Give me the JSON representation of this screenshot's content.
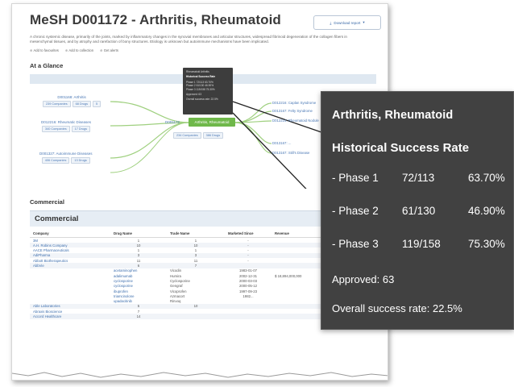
{
  "page": {
    "title": "MeSH D001172 - Arthritis, Rheumatoid",
    "download_label": "Download report",
    "description": "A chronic systemic disease, primarily of the joints, marked by inflammatory changes in the synovial membranes and articular structures, widespread fibrinoid degeneration of the collagen fibers in mesenchymal tissues, and by atrophy and rarefaction of bony structures. Etiology is unknown but autoimmune mechanisms have been implicated.",
    "links": [
      "Add to favourites",
      "Add to collection",
      "Get alerts"
    ]
  },
  "glance": {
    "heading": "At a Glance",
    "left_nodes": [
      {
        "label": "D001168: Arthritis",
        "chips": [
          "239 Companies",
          "68 Drugs",
          "5"
        ]
      },
      {
        "label": "D012216: Rheumatic Diseases",
        "chips": [
          "340 Companies",
          "17 Drugs"
        ]
      },
      {
        "label": "D001327: Autoimmune Diseases",
        "chips": [
          "406 Companies",
          "13 Drugs"
        ]
      }
    ],
    "center": {
      "id": "D001172",
      "label": "Arthritis, Rheumatoid",
      "chips": [
        "234 Companies",
        "386 Drugs"
      ]
    },
    "right_nodes": [
      "D012216: Caplan Syndrome",
      "D013167: Felty Syndrome",
      "D012214: Rheumatoid Nodule",
      "D013167: ...",
      "D013167: Still's Disease"
    ],
    "mini_tooltip": {
      "name": "Rheumatoid Arthritis",
      "heading": "Historical Success Rate",
      "rows": [
        "Phase 1  72/113  63.70%",
        "Phase 2  61/130  46.90%",
        "Phase 3  119/158  75.30%"
      ],
      "approved": "Approved: 63",
      "overall": "Overall success rate: 22.5%"
    }
  },
  "commercial": {
    "heading": "Commercial",
    "box_title": "Commercial",
    "columns": [
      "Company",
      "Drug Name",
      "Trade Name",
      "Marketed Since",
      "Revenue"
    ],
    "rows": [
      {
        "company": "3M",
        "drug": "1",
        "trade": "1",
        "since": "-",
        "rev": "",
        "shade": false
      },
      {
        "company": "A.H. Robins Company",
        "drug": "10",
        "trade": "10",
        "since": "-",
        "rev": "",
        "shade": true
      },
      {
        "company": "AACE Pharmaceuticals",
        "drug": "1",
        "trade": "1",
        "since": "-",
        "rev": "",
        "shade": false
      },
      {
        "company": "AdiPharma",
        "drug": "3",
        "trade": "3",
        "since": "-",
        "rev": "",
        "shade": true
      },
      {
        "company": "Abbott Biotherapeutics",
        "drug": "11",
        "trade": "11",
        "since": "-",
        "rev": "",
        "shade": false
      },
      {
        "company": "AbbVie",
        "drug": "6",
        "trade": "7",
        "since": "",
        "rev": "",
        "shade": true
      },
      {
        "company": "",
        "drug": "acetaminophen",
        "trade": "Vicodin",
        "since": "1983-01-07",
        "rev": "",
        "shade": false
      },
      {
        "company": "",
        "drug": "adalimumab",
        "trade": "Humira",
        "since": "2002-12-31",
        "rev": "$  18,894,000,000",
        "shade": false
      },
      {
        "company": "",
        "drug": "cyclosporine",
        "trade": "Cyclosporine",
        "since": "2000-03-03",
        "rev": "",
        "shade": false
      },
      {
        "company": "",
        "drug": "cyclosporine",
        "trade": "Gengraf",
        "since": "2000-05-12",
        "rev": "",
        "shade": false
      },
      {
        "company": "",
        "drug": "ibuprofen",
        "trade": "Vicoprofen",
        "since": "1997-09-23",
        "rev": "",
        "shade": false
      },
      {
        "company": "",
        "drug": "triamcinolone",
        "trade": "Azmacort",
        "since": "1982...",
        "rev": "",
        "shade": false
      },
      {
        "company": "",
        "drug": "upadacitinib",
        "trade": "Rinvoq",
        "since": "",
        "rev": "",
        "shade": false
      },
      {
        "company": "Able Laboratories",
        "drug": "5",
        "trade": "10",
        "since": "",
        "rev": "",
        "shade": true
      },
      {
        "company": "Abraxis Bioscience",
        "drug": "7",
        "trade": "",
        "since": "",
        "rev": "",
        "shade": false
      },
      {
        "company": "Accord Healthcare",
        "drug": "14",
        "trade": "",
        "since": "",
        "rev": "",
        "shade": true
      }
    ]
  },
  "tooltip": {
    "name": "Arthritis, Rheumatoid",
    "heading": "Historical Success Rate",
    "phases": [
      {
        "phase": "- Phase 1",
        "count": "72/113",
        "pct": "63.70%"
      },
      {
        "phase": "- Phase 2",
        "count": "61/130",
        "pct": "46.90%"
      },
      {
        "phase": "- Phase 3",
        "count": "119/158",
        "pct": "75.30%"
      }
    ],
    "approved": "Approved: 63",
    "overall": "Overall success rate: 22.5%"
  },
  "colors": {
    "tooltip_bg": "#414141",
    "center_node": "#6fb84a",
    "link": "#3e6fae"
  }
}
